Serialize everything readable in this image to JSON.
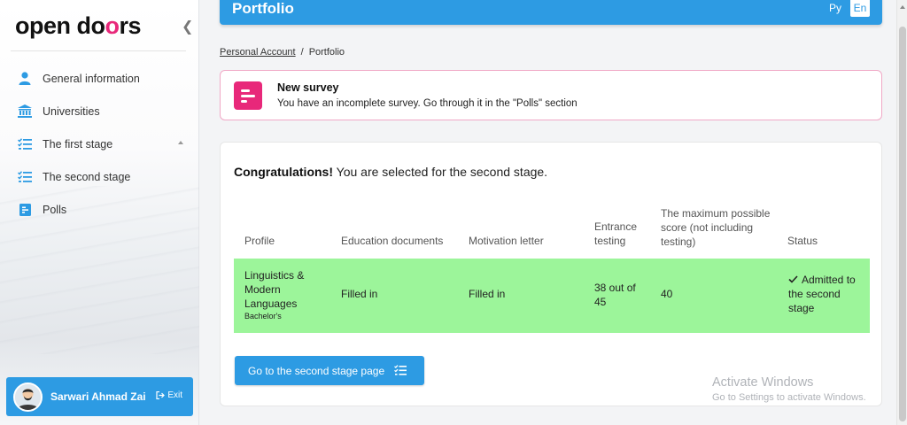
{
  "sidebar": {
    "logo_pre": "open do",
    "logo_o": "o",
    "logo_post": "rs",
    "collapse_glyph": "❮",
    "items": [
      {
        "label": "General information",
        "icon": "person-icon"
      },
      {
        "label": "Universities",
        "icon": "university-icon"
      },
      {
        "label": "The first stage",
        "icon": "checklist-icon"
      },
      {
        "label": "The second stage",
        "icon": "checklist-icon"
      },
      {
        "label": "Polls",
        "icon": "poll-icon"
      }
    ],
    "user_name": "Sarwari Ahmad Zai",
    "exit_label": "Exit"
  },
  "header": {
    "title": "Portfolio",
    "lang_ru": "Ру",
    "lang_en": "En"
  },
  "breadcrumb": {
    "root": "Personal Account",
    "separator": "/",
    "current": "Portfolio"
  },
  "survey": {
    "title": "New survey",
    "text": "You have an incomplete survey. Go through it in the \"Polls\" section"
  },
  "main": {
    "congrats_bold": "Congratulations!",
    "congrats_rest": " You are selected for the second stage.",
    "table": {
      "headers": [
        "Profile",
        "Education documents",
        "Motivation letter",
        "Entrance testing",
        "The maximum possible score (not including testing)",
        "Status"
      ],
      "row": {
        "profile": "Linguistics & Modern Languages",
        "degree": "Bachelor's",
        "education": "Filled in",
        "motivation": "Filled in",
        "testing": "38 out of 45",
        "max_score": "40",
        "status": "Admitted to the second stage"
      }
    },
    "button_label": "Go to the second stage page"
  },
  "watermark": {
    "line1": "Activate Windows",
    "line2": "Go to Settings to activate Windows."
  },
  "colors": {
    "primary": "#2d9be3",
    "accent": "#e8287a",
    "success_row": "#9cf59a"
  }
}
